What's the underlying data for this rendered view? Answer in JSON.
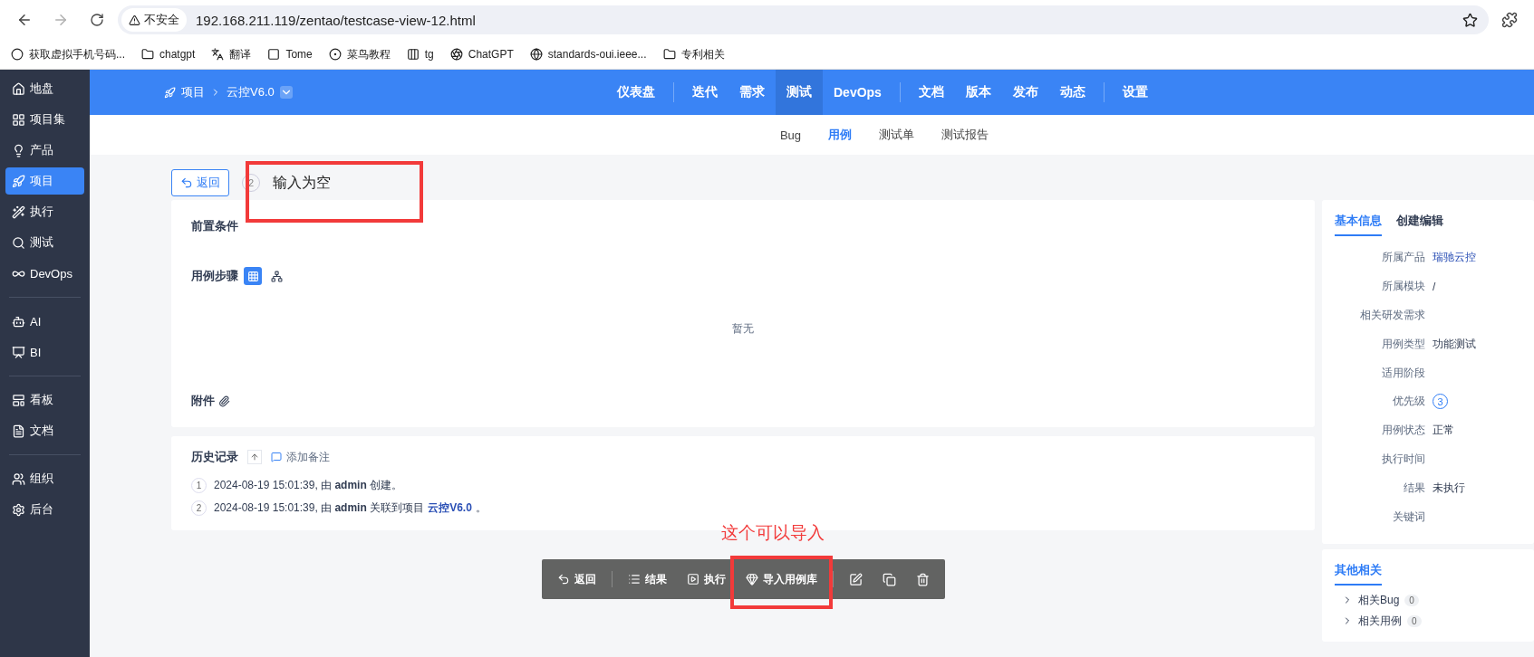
{
  "browser": {
    "security": "不安全",
    "url": "192.168.211.119/zentao/testcase-view-12.html",
    "bookmarks": [
      {
        "label": "获取虚拟手机号码..."
      },
      {
        "label": "chatgpt"
      },
      {
        "label": "翻译"
      },
      {
        "label": "Tome"
      },
      {
        "label": "菜鸟教程"
      },
      {
        "label": "tg"
      },
      {
        "label": "ChatGPT"
      },
      {
        "label": "standards-oui.ieee..."
      },
      {
        "label": "专利相关"
      }
    ]
  },
  "sidebar": {
    "groups": [
      [
        {
          "label": "地盘",
          "selected": false
        },
        {
          "label": "项目集",
          "selected": false
        },
        {
          "label": "产品",
          "selected": false
        },
        {
          "label": "项目",
          "selected": true
        },
        {
          "label": "执行",
          "selected": false
        },
        {
          "label": "测试",
          "selected": false
        },
        {
          "label": "DevOps",
          "selected": false
        }
      ],
      [
        {
          "label": "AI",
          "selected": false
        },
        {
          "label": "BI",
          "selected": false
        }
      ],
      [
        {
          "label": "看板",
          "selected": false
        },
        {
          "label": "文档",
          "selected": false
        }
      ],
      [
        {
          "label": "组织",
          "selected": false
        },
        {
          "label": "后台",
          "selected": false
        }
      ]
    ]
  },
  "header": {
    "breadcrumb": [
      "项目",
      "云控V6.0"
    ],
    "nav_groups": [
      [
        {
          "label": "仪表盘",
          "selected": false
        }
      ],
      [
        {
          "label": "迭代",
          "selected": false
        },
        {
          "label": "需求",
          "selected": false
        },
        {
          "label": "测试",
          "selected": true
        },
        {
          "label": "DevOps",
          "selected": false
        }
      ],
      [
        {
          "label": "文档",
          "selected": false
        },
        {
          "label": "版本",
          "selected": false
        },
        {
          "label": "发布",
          "selected": false
        },
        {
          "label": "动态",
          "selected": false
        }
      ],
      [
        {
          "label": "设置",
          "selected": false
        }
      ]
    ],
    "subnav": [
      {
        "label": "Bug",
        "selected": false
      },
      {
        "label": "用例",
        "selected": true
      },
      {
        "label": "测试单",
        "selected": false
      },
      {
        "label": "测试报告",
        "selected": false
      }
    ]
  },
  "case": {
    "back": "返回",
    "id": "2",
    "title": "输入为空"
  },
  "main": {
    "precondition_label": "前置条件",
    "steps_label": "用例步骤",
    "step_views": [
      {
        "selected": true
      },
      {
        "selected": false
      }
    ],
    "empty_text": "暂无",
    "files_label": "附件"
  },
  "history": {
    "title": "历史记录",
    "add_note": "添加备注",
    "entries": [
      {
        "index": "1",
        "text": "2024-08-19 15:01:39, 由 **admin** 创建。"
      },
      {
        "index": "2",
        "text": "2024-08-19 15:01:39, 由 **admin** 关联到项目",
        "link": "云控V6.0",
        "after": "。"
      }
    ]
  },
  "toolbar": {
    "buttons": [
      {
        "label": "返回"
      },
      {
        "label": "结果"
      },
      {
        "label": "执行"
      },
      {
        "label": "导入用例库"
      }
    ]
  },
  "basic_info": {
    "tabs": [
      {
        "label": "基本信息",
        "selected": true
      },
      {
        "label": "创建编辑",
        "selected": false
      }
    ],
    "fields": [
      {
        "label": "所属产品",
        "value": "瑞驰云控",
        "kind": "link"
      },
      {
        "label": "所属模块",
        "value": "/",
        "kind": "text"
      },
      {
        "label": "相关研发需求"
      },
      {
        "label": "用例类型",
        "value": "功能测试",
        "kind": "text"
      },
      {
        "label": "适用阶段"
      },
      {
        "label": "优先级",
        "value": "3",
        "kind": "priority"
      },
      {
        "label": "用例状态",
        "value": "正常",
        "kind": "text"
      },
      {
        "label": "执行时间"
      },
      {
        "label": "结果",
        "value": "未执行",
        "kind": "text"
      },
      {
        "label": "关键词"
      }
    ]
  },
  "related": {
    "tabs": [
      {
        "label": "其他相关",
        "selected": true
      }
    ],
    "items": [
      {
        "label": "相关Bug",
        "count": "0"
      },
      {
        "label": "相关用例",
        "count": "0"
      }
    ]
  },
  "annotations": {
    "title_box": true,
    "import_note": "这个可以导入",
    "import_box": true
  }
}
